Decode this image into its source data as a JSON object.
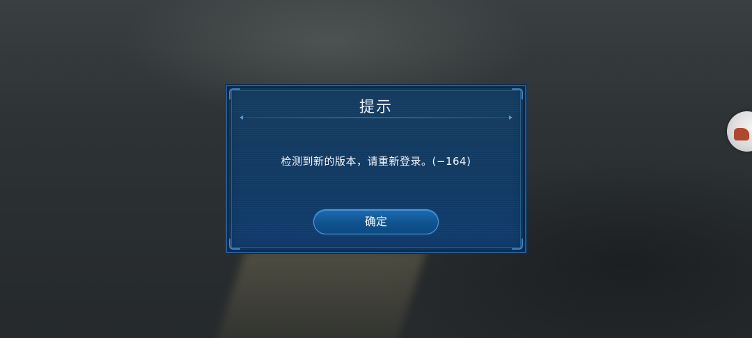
{
  "dialog": {
    "title": "提示",
    "message": "检测到新的版本，请重新登录。(−164)",
    "confirm_label": "确定"
  },
  "colors": {
    "dialog_background": "#123a62",
    "dialog_border": "#1f5e9a",
    "button_background": "#10538f",
    "button_border": "#4da3e4",
    "text": "#f2f5f8"
  },
  "icons": {
    "side_button": "avatar-icon"
  }
}
